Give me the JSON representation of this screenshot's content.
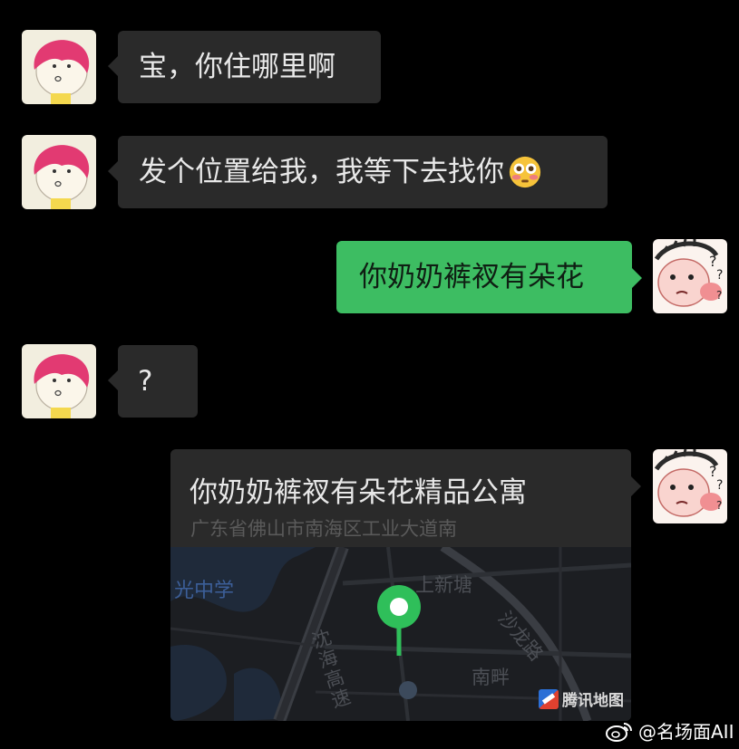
{
  "chat": {
    "messages": [
      {
        "side": "left",
        "text": "宝，你住哪里啊"
      },
      {
        "side": "left",
        "text": "发个位置给我，我等下去找你",
        "emoji": "flushed-face-emoji"
      },
      {
        "side": "right",
        "text": "你奶奶裤衩有朵花"
      },
      {
        "side": "left",
        "text": "?"
      }
    ],
    "location": {
      "title": "你奶奶裤衩有朵花精品公寓",
      "address": "广东省佛山市南海区工业大道南",
      "map_labels": {
        "school": "光中学",
        "shangxintang": "上新塘",
        "shalong_road": "沙龙路",
        "highway": "沈海高速",
        "nanpan": "南畔"
      },
      "provider": "腾讯地图"
    }
  },
  "colors": {
    "background": "#000000",
    "bubble_left": "#2a2a2a",
    "bubble_right": "#3dbd62",
    "pin": "#2fbf5a"
  },
  "watermark": {
    "text": "@名场面AII"
  }
}
